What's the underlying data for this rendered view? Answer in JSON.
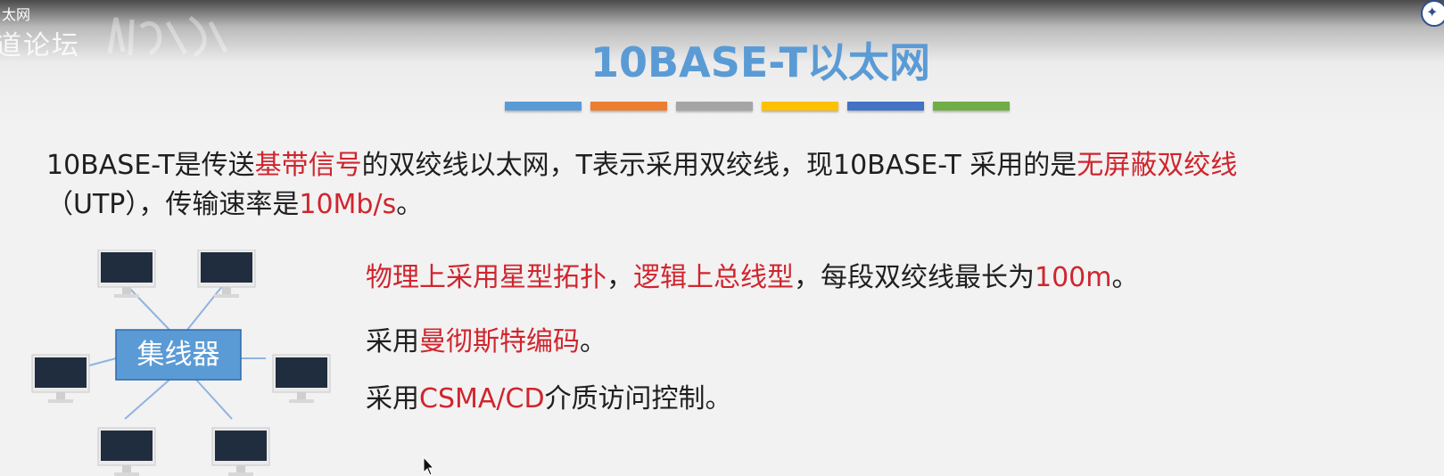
{
  "window": {
    "title": "太网"
  },
  "watermark": {
    "forum_text": "道论坛"
  },
  "slide": {
    "title": "10BASE-T以太网",
    "color_bars": [
      "#5b9bd5",
      "#ed7d31",
      "#a5a5a5",
      "#ffc000",
      "#4472c4",
      "#70ad47"
    ],
    "intro": {
      "line1": [
        {
          "text": "10BASE-T是传送",
          "highlight": false
        },
        {
          "text": "基带信号",
          "highlight": true
        },
        {
          "text": "的双绞线以太网，T表示采用双绞线，现10BASE-T 采用的是",
          "highlight": false
        },
        {
          "text": "无屏蔽双绞线",
          "highlight": true
        }
      ],
      "line2": [
        {
          "text": "（UTP），传输速率是",
          "highlight": false
        },
        {
          "text": "10Mb/s",
          "highlight": true
        },
        {
          "text": "。",
          "highlight": false
        }
      ]
    },
    "diagram": {
      "hub_label": "集线器"
    },
    "bullets": [
      [
        {
          "text": "物理上采用星型拓扑",
          "highlight": true
        },
        {
          "text": "，",
          "highlight": false
        },
        {
          "text": "逻辑上总线型",
          "highlight": true
        },
        {
          "text": "，每段双绞线最长为",
          "highlight": false
        },
        {
          "text": "100m",
          "highlight": true
        },
        {
          "text": "。",
          "highlight": false
        }
      ],
      [
        {
          "text": "采用",
          "highlight": false
        },
        {
          "text": "曼彻斯特编码",
          "highlight": true
        },
        {
          "text": "。",
          "highlight": false
        }
      ],
      [
        {
          "text": "采用",
          "highlight": false
        },
        {
          "text": "CSMA/CD",
          "highlight": true
        },
        {
          "text": "介质访问控制。",
          "highlight": false
        }
      ]
    ]
  },
  "colors": {
    "accent_title": "#5b9bd5",
    "highlight_red": "#d0252e",
    "hub_fill": "#5b9bd5"
  },
  "icons": [
    "monitor-icon",
    "mouse-cursor-icon",
    "university-logo-icon"
  ]
}
